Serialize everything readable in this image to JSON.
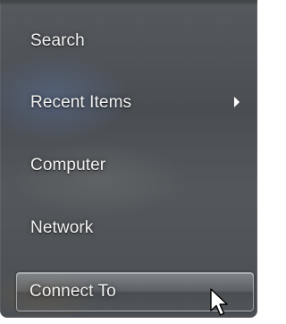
{
  "start_menu_right_pane": {
    "items": [
      {
        "label": "Search",
        "has_submenu": false
      },
      {
        "label": "Recent Items",
        "has_submenu": true
      },
      {
        "label": "Computer",
        "has_submenu": false
      },
      {
        "label": "Network",
        "has_submenu": false
      },
      {
        "label": "Connect To",
        "has_submenu": false,
        "highlighted": true
      }
    ]
  },
  "icons": {
    "submenu": "chevron-right-icon",
    "pointer": "mouse-pointer-icon"
  },
  "colors": {
    "text": "#f2f2f2",
    "panel": "#505459",
    "highlight_border": "#dce1e6"
  }
}
